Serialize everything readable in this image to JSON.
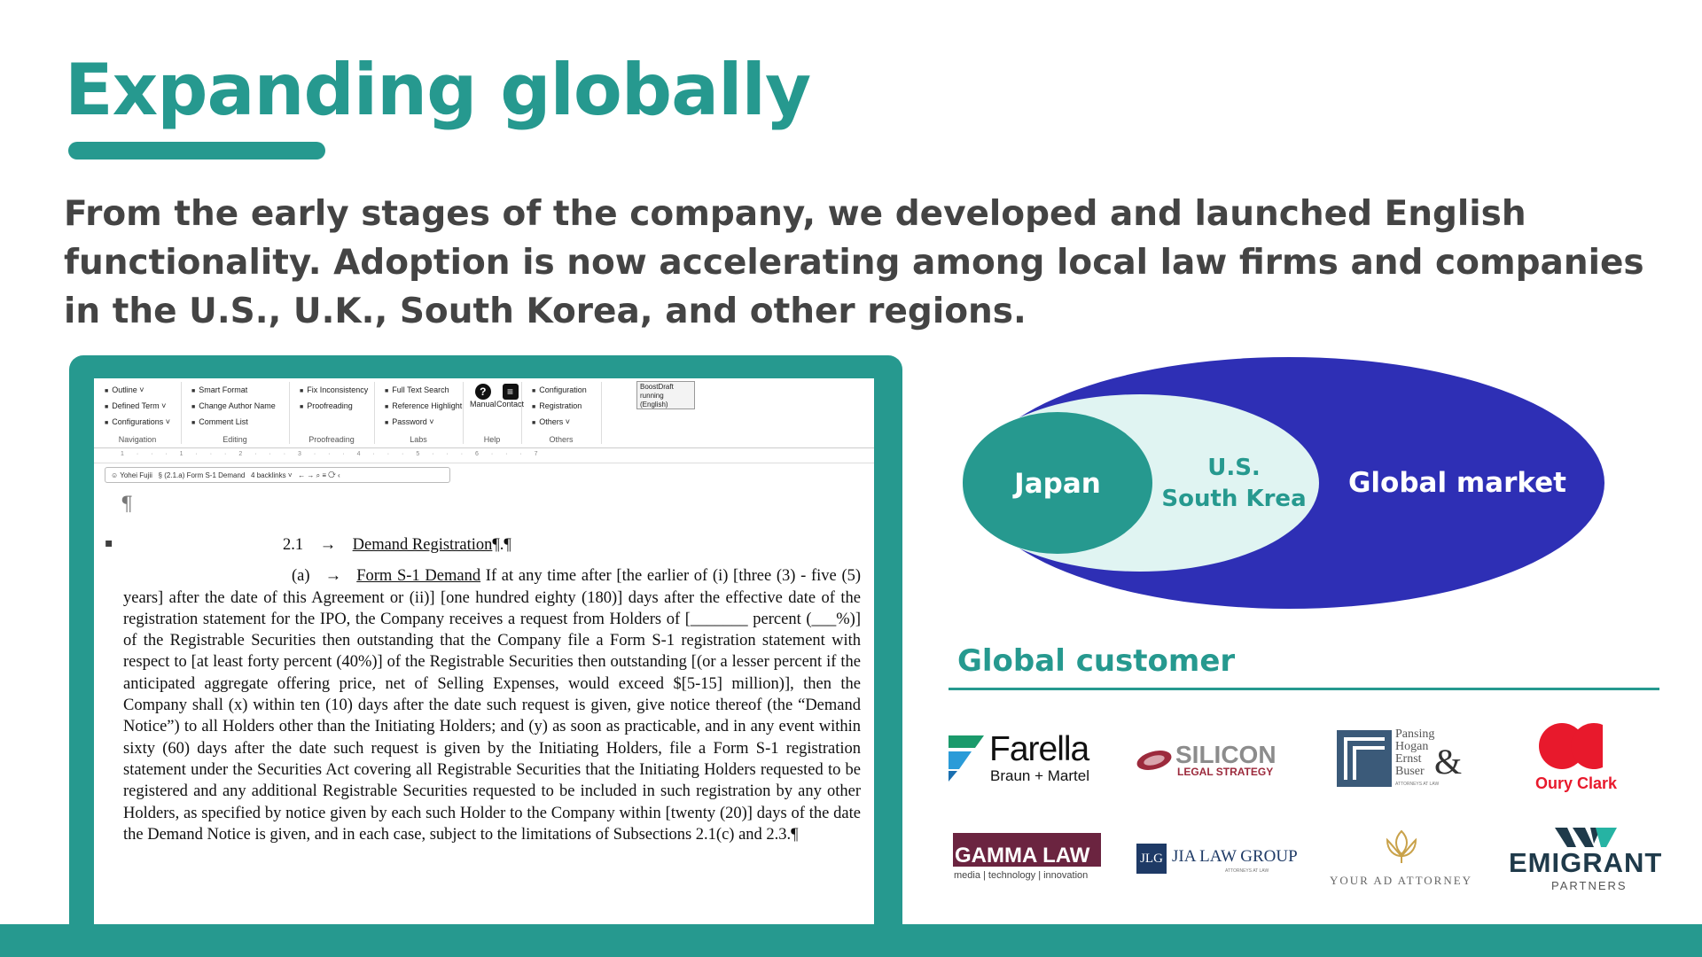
{
  "title": "Expanding globally",
  "subtitle": "From the early stages of the company, we developed and launched English functionality. Adoption is now accelerating among local law firms and companies in the U.S., U.K., South Korea, and other regions.",
  "colors": {
    "accent": "#26998f",
    "market_blue": "#2e2fb5",
    "light_teal": "#e0f4f2"
  },
  "editor": {
    "ribbon": {
      "navigation": {
        "items": [
          "Outline ˅",
          "Defined Term ˅",
          "Configurations ˅"
        ],
        "label": "Navigation"
      },
      "editing": {
        "items": [
          "Smart Format",
          "Change Author Name",
          "Comment List"
        ],
        "label": "Editing"
      },
      "proofreading": {
        "items": [
          "Fix Inconsistency",
          "Proofreading"
        ],
        "label": "Proofreading"
      },
      "labs": {
        "items": [
          "Full Text Search",
          "Reference Highlight",
          "Password ˅"
        ],
        "label": "Labs"
      },
      "help": {
        "manual": "Manual",
        "contact": "Contact",
        "label": "Help"
      },
      "others": {
        "items": [
          "Configuration",
          "Registration",
          "Others ˅"
        ],
        "label": "Others"
      },
      "status": "BoostDraft running (English)"
    },
    "ruler": "1 · · · 1 · · · 2 · · · 3 · · · 4 · · · 5 · · · 6 · · · 7",
    "docbar": {
      "user": "Yohei Fujii",
      "section": "(2.1.a) Form S-1 Demand",
      "backlinks": "4 backlinks ˅"
    },
    "pilcrow": "¶",
    "heading_number": "2.1",
    "heading_arrow": "→",
    "heading_text": "Demand Registration",
    "heading_mark": "¶.¶",
    "para_label": "(a)",
    "para_arrow": "→",
    "para_title": "Form S-1 Demand",
    "para_body": "If at any time after [the earlier of (i) [three (3) - five (5) years] after the date of this Agreement or (ii)] [one hundred eighty (180)] days after the effective date of the registration statement for the IPO, the Company receives a request from Holders of [_______ percent (___%)] of the Registrable Securities then outstanding that the Company file a Form S-1 registration statement with respect to [at least forty percent (40%)] of the Registrable Securities then outstanding [(or a lesser percent if the anticipated aggregate offering price, net of Selling Expenses, would exceed $[5-15] million)], then the Company shall (x) within ten (10) days after the date such request is given, give notice thereof (the “Demand Notice”) to all Holders other than the Initiating Holders; and (y) as soon as practicable, and in any event within sixty (60) days after the date such request is given by the Initiating Holders, file a Form S-1 registration statement under the Securities Act covering all Registrable Securities that the Initiating Holders requested to be registered and any additional Registrable Securities requested to be included in such registration by any other Holders, as specified by notice given by each such Holder to the Company within [twenty (20)] days of the date the Demand Notice is given, and in each case, subject to the limitations of Subsections 2.1(c) and 2.3.¶"
  },
  "diagram": {
    "outer": "Global market",
    "middle_line1": "U.S.",
    "middle_line2": "South Krea",
    "inner": "Japan"
  },
  "global_customer": {
    "title": "Global customer",
    "logos": {
      "farella": {
        "line1": "Farella",
        "line2": "Braun + Martel"
      },
      "silicon": {
        "line1": "SILICON",
        "line2": "LEGAL STRATEGY"
      },
      "pansing": {
        "line1": "Pansing",
        "line2": "Hogan",
        "line3": "Ernst",
        "line4": "Buser",
        "amp": "&",
        "tag": "ATTORNEYS AT LAW"
      },
      "oury": {
        "name": "Oury Clark"
      },
      "gamma": {
        "line1": "GAMMA LAW",
        "line2": "media | technology | innovation"
      },
      "jia": {
        "mark": "JLG",
        "name": "JIA LAW GROUP",
        "tag": "ATTORNEYS AT LAW"
      },
      "yad": {
        "name": "YOUR AD ATTORNEY"
      },
      "emigrant": {
        "line1": "EMIGRANT",
        "line2": "PARTNERS"
      }
    }
  }
}
